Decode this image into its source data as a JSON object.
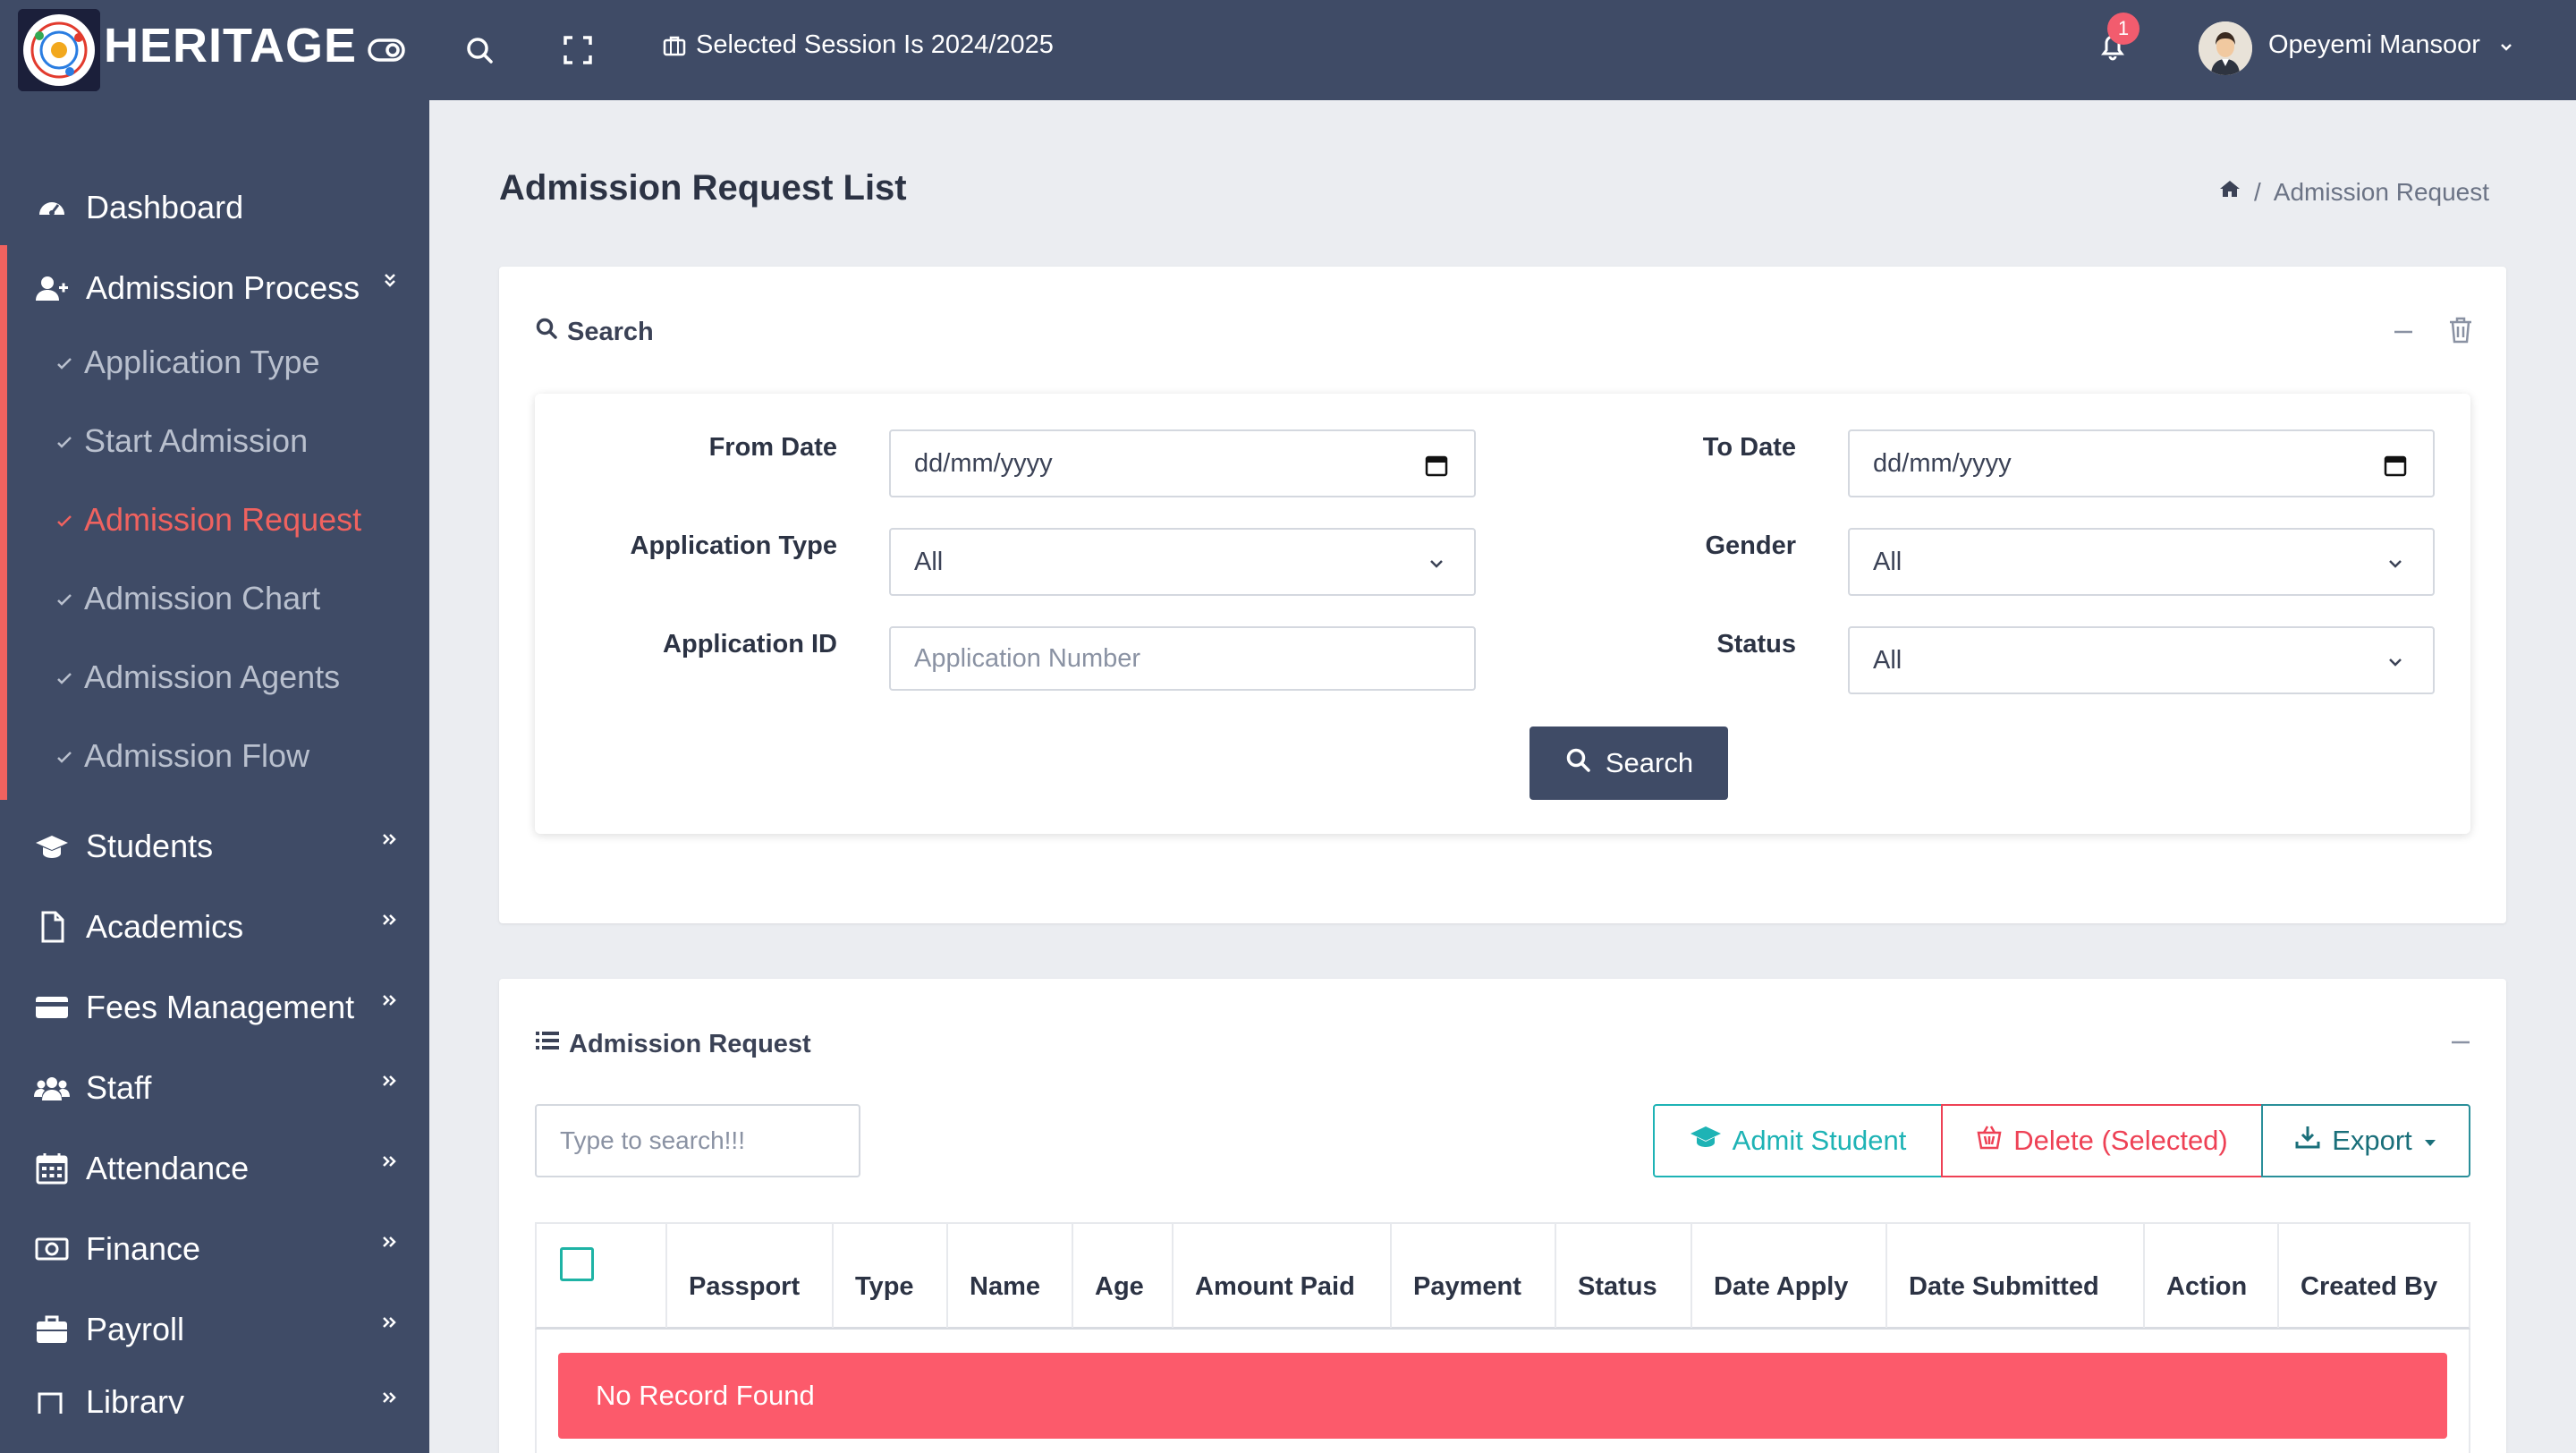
{
  "topbar": {
    "brand": "HERITAGE",
    "session_text": "Selected Session Is 2024/2025",
    "notification_count": "1",
    "user_name": "Opeyemi Mansoor"
  },
  "sidebar": {
    "items": [
      {
        "label": "Dashboard",
        "icon": "dashboard-icon"
      },
      {
        "label": "Admission Process",
        "icon": "user-plus-icon"
      },
      {
        "label": "Students",
        "icon": "graduation-cap-icon"
      },
      {
        "label": "Academics",
        "icon": "file-icon"
      },
      {
        "label": "Fees Management",
        "icon": "credit-card-icon"
      },
      {
        "label": "Staff",
        "icon": "users-icon"
      },
      {
        "label": "Attendance",
        "icon": "calendar-icon"
      },
      {
        "label": "Finance",
        "icon": "money-icon"
      },
      {
        "label": "Payroll",
        "icon": "briefcase-icon"
      },
      {
        "label": "Library",
        "icon": "book-icon"
      }
    ],
    "submenu": [
      {
        "label": "Application Type",
        "active": false
      },
      {
        "label": "Start Admission",
        "active": false
      },
      {
        "label": "Admission Request",
        "active": true
      },
      {
        "label": "Admission Chart",
        "active": false
      },
      {
        "label": "Admission Agents",
        "active": false
      },
      {
        "label": "Admission Flow",
        "active": false
      }
    ],
    "accent_color": "#f0625f"
  },
  "page": {
    "title": "Admission Request List",
    "breadcrumb_current": "Admission Request",
    "breadcrumb_separator": "/"
  },
  "search_card": {
    "title": "Search",
    "from_date_label": "From Date",
    "from_date_value": "dd/mm/yyyy",
    "to_date_label": "To Date",
    "to_date_value": "dd/mm/yyyy",
    "application_type_label": "Application Type",
    "application_type_value": "All",
    "gender_label": "Gender",
    "gender_value": "All",
    "application_id_label": "Application ID",
    "application_id_placeholder": "Application Number",
    "status_label": "Status",
    "status_value": "All",
    "search_button": "Search"
  },
  "table_card": {
    "title": "Admission Request",
    "search_placeholder": "Type to search!!!",
    "admit_button": "Admit Student",
    "delete_button": "Delete (Selected)",
    "export_button": "Export",
    "columns": [
      "Passport",
      "Type",
      "Name",
      "Age",
      "Amount Paid",
      "Payment",
      "Status",
      "Date Apply",
      "Date Submitted",
      "Action",
      "Created By"
    ],
    "empty_message": "No Record Found"
  },
  "colors": {
    "navy": "#3f4b66",
    "teal": "#1eb3b5",
    "danger": "#fc5a6b"
  }
}
